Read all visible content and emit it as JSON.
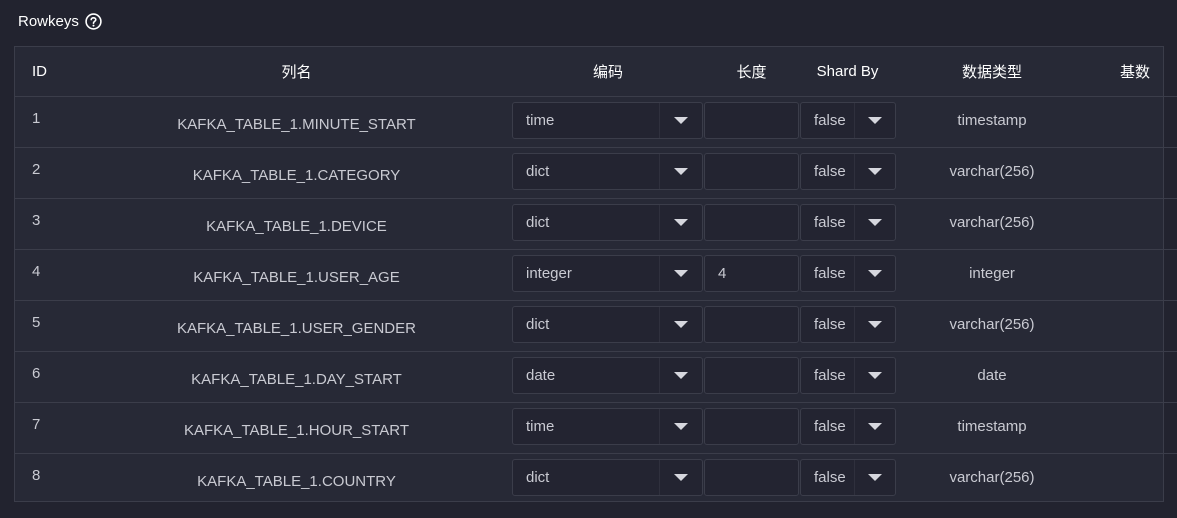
{
  "section": {
    "title": "Rowkeys",
    "help_icon": "question-circle-icon"
  },
  "table": {
    "columns": [
      "ID",
      "列名",
      "编码",
      "长度",
      "Shard By",
      "数据类型",
      "基数"
    ],
    "rows": [
      {
        "id": "1",
        "name": "KAFKA_TABLE_1.MINUTE_START",
        "encoding": "time",
        "length": "",
        "shard_by": "false",
        "data_type": "timestamp",
        "cardinality": ""
      },
      {
        "id": "2",
        "name": "KAFKA_TABLE_1.CATEGORY",
        "encoding": "dict",
        "length": "",
        "shard_by": "false",
        "data_type": "varchar(256)",
        "cardinality": ""
      },
      {
        "id": "3",
        "name": "KAFKA_TABLE_1.DEVICE",
        "encoding": "dict",
        "length": "",
        "shard_by": "false",
        "data_type": "varchar(256)",
        "cardinality": ""
      },
      {
        "id": "4",
        "name": "KAFKA_TABLE_1.USER_AGE",
        "encoding": "integer",
        "length": "4",
        "shard_by": "false",
        "data_type": "integer",
        "cardinality": ""
      },
      {
        "id": "5",
        "name": "KAFKA_TABLE_1.USER_GENDER",
        "encoding": "dict",
        "length": "",
        "shard_by": "false",
        "data_type": "varchar(256)",
        "cardinality": ""
      },
      {
        "id": "6",
        "name": "KAFKA_TABLE_1.DAY_START",
        "encoding": "date",
        "length": "",
        "shard_by": "false",
        "data_type": "date",
        "cardinality": ""
      },
      {
        "id": "7",
        "name": "KAFKA_TABLE_1.HOUR_START",
        "encoding": "time",
        "length": "",
        "shard_by": "false",
        "data_type": "timestamp",
        "cardinality": ""
      },
      {
        "id": "8",
        "name": "KAFKA_TABLE_1.COUNTRY",
        "encoding": "dict",
        "length": "",
        "shard_by": "false",
        "data_type": "varchar(256)",
        "cardinality": ""
      }
    ]
  },
  "colors": {
    "background": "#22232f",
    "table_bg": "#272936",
    "border": "#3b3d4a",
    "text": "#c9cad2",
    "header_text": "#ffffff"
  }
}
